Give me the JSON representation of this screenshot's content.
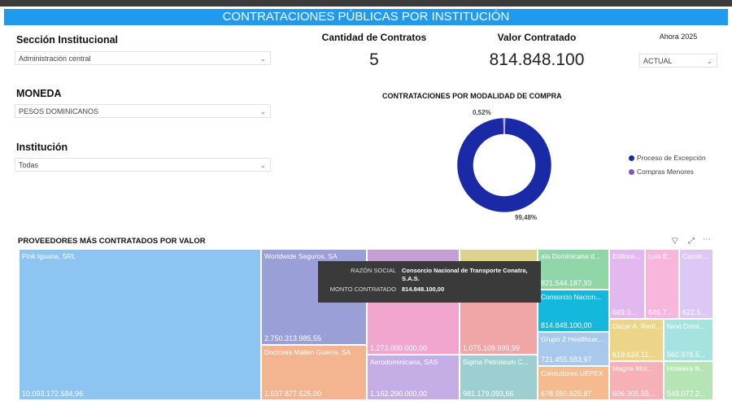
{
  "header": {
    "title": "CONTRATACIONES PÚBLICAS POR INSTITUCIÓN"
  },
  "filters": {
    "seccion": {
      "label": "Sección Institucional",
      "value": "Administración central"
    },
    "moneda": {
      "label": "MONEDA",
      "value": "PESOS DOMINICANOS"
    },
    "institucion": {
      "label": "Institución",
      "value": "Todas"
    },
    "ahora": {
      "label": "Ahora 2025",
      "value": "ACTUAL"
    }
  },
  "kpis": {
    "cantidad": {
      "label": "Cantidad de Contratos",
      "value": "5"
    },
    "valor": {
      "label": "Valor Contratado",
      "value": "814.848.100"
    }
  },
  "donut": {
    "title": "CONTRATACIONES POR MODALIDAD DE COMPRA",
    "label_small": "0,52%",
    "label_large": "99,48%",
    "colors": {
      "main": "#1a2aa6",
      "minor": "#7b56c8"
    },
    "legend": [
      {
        "name": "Proceso de Excepción",
        "color": "#1a2aa6"
      },
      {
        "name": "Compras Menores",
        "color": "#7b56c8"
      }
    ]
  },
  "chart_data": {
    "type": "pie",
    "title": "CONTRATACIONES POR MODALIDAD DE COMPRA",
    "categories": [
      "Proceso de Excepción",
      "Compras Menores"
    ],
    "values": [
      99.48,
      0.52
    ]
  },
  "treemap": {
    "title": "PROVEEDORES MÁS CONTRATADOS POR VALOR",
    "cells": [
      {
        "name": "Pink Iguana, SRL",
        "value": "10.093.172.584,96",
        "color": "#8cc4f2"
      },
      {
        "name": "Worldwide Seguros, SA",
        "value": "2.750.313.985,55",
        "color": "#9a9fd8"
      },
      {
        "name": "Doctores Mallen Guerra, SA",
        "value": "1.637.877.625,00",
        "color": "#f4b48f"
      },
      {
        "name": "",
        "value": "",
        "color": "#c59fd6"
      },
      {
        "name": "Banco de Reservas de la ...",
        "value": "1.273.000.000,00",
        "color": "#f2a6cf"
      },
      {
        "name": "Aerodominicana, SAS",
        "value": "1.162.200.000,00",
        "color": "#c5aee6"
      },
      {
        "name": "",
        "value": "",
        "color": "#ddd48c"
      },
      {
        "name": "All Media, SRL",
        "value": "1.075.109.999,99",
        "color": "#f0a6a6"
      },
      {
        "name": "Sigma Petroleum C...",
        "value": "981.179.093,66",
        "color": "#9ecfd0"
      },
      {
        "name": "ala Dominicana d...",
        "value": "821.544.187,93",
        "color": "#8fd6a8"
      },
      {
        "name": "Consorcio Nacion...",
        "value": "814.848.100,00",
        "color": "#14b8dc"
      },
      {
        "name": "Grupo Z Healthcar...",
        "value": "721.455.583,97",
        "color": "#a8c9ec"
      },
      {
        "name": "Consultores UEPEX",
        "value": "678.950.625,87",
        "color": "#f5bb8e"
      },
      {
        "name": "Editora...",
        "value": "669.0...",
        "color": "#e3b8ee"
      },
      {
        "name": "Luis E...",
        "value": "646.7...",
        "color": "#f8b6dd"
      },
      {
        "name": "Constr...",
        "value": "622.5...",
        "color": "#dcc8f4"
      },
      {
        "name": "Oscar A. Rent...",
        "value": "619.624.11...",
        "color": "#ecd489"
      },
      {
        "name": "Next Domi...",
        "value": "560.976.5...",
        "color": "#a5e3e1"
      },
      {
        "name": "Magna Mot...",
        "value": "606.305.55...",
        "color": "#f6b0b6"
      },
      {
        "name": "Hotelera B...",
        "value": "549.077.2...",
        "color": "#b5e5b5"
      }
    ]
  },
  "tooltip": {
    "k1": "RAZÓN SOCIAL",
    "v1": "Consorcio Nacional de Transporte Conatra, S.A.S.",
    "k2": "MONTO CONTRATADO",
    "v2": "814.848.100,00"
  },
  "icons": {
    "filter": "filter-icon",
    "expand": "expand-icon",
    "more": "more-icon"
  }
}
